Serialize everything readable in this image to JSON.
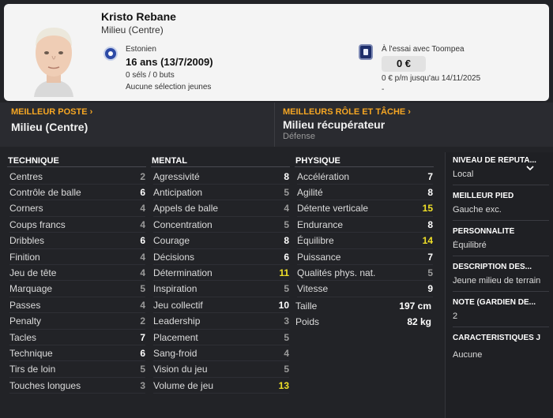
{
  "player": {
    "name": "Kristo Rebane",
    "position": "Milieu (Centre)",
    "nationality": "Estonien",
    "age": "16 ans (13/7/2009)",
    "caps": "0 séls / 0 buts",
    "youth_caps": "Aucune sélection jeunes",
    "contract_status": "À l'essai avec Toompea",
    "value": "0 €",
    "wage": "0 € p/m jusqu'au 14/11/2025",
    "extra": "-"
  },
  "best_position": {
    "header": "MEILLEUR POSTE ›",
    "value": "Milieu (Centre)"
  },
  "best_role": {
    "header": "MEILLEURS RÔLE ET TÂCHE ›",
    "value": "Milieu récupérateur",
    "duty": "Défense"
  },
  "technique": {
    "header": "TECHNIQUE",
    "attributes": [
      {
        "label": "Centres",
        "value": "2"
      },
      {
        "label": "Contrôle de balle",
        "value": "6"
      },
      {
        "label": "Corners",
        "value": "4"
      },
      {
        "label": "Coups francs",
        "value": "4"
      },
      {
        "label": "Dribbles",
        "value": "6"
      },
      {
        "label": "Finition",
        "value": "4"
      },
      {
        "label": "Jeu de tête",
        "value": "4"
      },
      {
        "label": "Marquage",
        "value": "5"
      },
      {
        "label": "Passes",
        "value": "4"
      },
      {
        "label": "Penalty",
        "value": "2"
      },
      {
        "label": "Tacles",
        "value": "7"
      },
      {
        "label": "Technique",
        "value": "6"
      },
      {
        "label": "Tirs de loin",
        "value": "5"
      },
      {
        "label": "Touches longues",
        "value": "3"
      }
    ]
  },
  "mental": {
    "header": "MENTAL",
    "attributes": [
      {
        "label": "Agressivité",
        "value": "8"
      },
      {
        "label": "Anticipation",
        "value": "5"
      },
      {
        "label": "Appels de balle",
        "value": "4"
      },
      {
        "label": "Concentration",
        "value": "5"
      },
      {
        "label": "Courage",
        "value": "8"
      },
      {
        "label": "Décisions",
        "value": "6"
      },
      {
        "label": "Détermination",
        "value": "11"
      },
      {
        "label": "Inspiration",
        "value": "5"
      },
      {
        "label": "Jeu collectif",
        "value": "10"
      },
      {
        "label": "Leadership",
        "value": "3"
      },
      {
        "label": "Placement",
        "value": "5"
      },
      {
        "label": "Sang-froid",
        "value": "4"
      },
      {
        "label": "Vision du jeu",
        "value": "5"
      },
      {
        "label": "Volume de jeu",
        "value": "13"
      }
    ]
  },
  "physique": {
    "header": "PHYSIQUE",
    "attributes": [
      {
        "label": "Accélération",
        "value": "7"
      },
      {
        "label": "Agilité",
        "value": "8"
      },
      {
        "label": "Détente verticale",
        "value": "15"
      },
      {
        "label": "Endurance",
        "value": "8"
      },
      {
        "label": "Équilibre",
        "value": "14"
      },
      {
        "label": "Puissance",
        "value": "7"
      },
      {
        "label": "Qualités phys. nat.",
        "value": "5"
      },
      {
        "label": "Vitesse",
        "value": "9"
      }
    ],
    "height_label": "Taille",
    "height": "197 cm",
    "weight_label": "Poids",
    "weight": "82 kg"
  },
  "info": {
    "reputation_header": "NIVEAU DE RÉPUTA...",
    "reputation": "Local",
    "foot_header": "MEILLEUR PIED",
    "foot": "Gauche exc.",
    "personality_header": "PERSONNALITÉ",
    "personality": "Équilibré",
    "description_header": "DESCRIPTION DES...",
    "description": "Jeune milieu de terrain",
    "gk_header": "NOTE (GARDIEN DE...",
    "gk": "2",
    "traits_header": "CARACTÉRISTIQUES J",
    "traits": "Aucune"
  },
  "icons": {
    "chevron": "chevron-down-icon",
    "flag": "estonia-flag-icon",
    "club": "club-badge-icon"
  },
  "colors": {
    "accent": "#f5a623",
    "highlight": "#f0e028",
    "background": "#222327",
    "card": "#f4f4f4"
  }
}
